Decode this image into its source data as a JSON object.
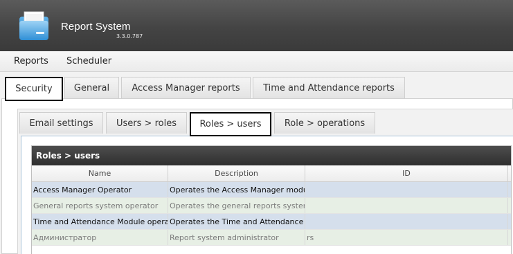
{
  "app": {
    "title": "Report System",
    "version": "3.3.0.787"
  },
  "menu": {
    "items": [
      {
        "label": "Reports"
      },
      {
        "label": "Scheduler"
      }
    ]
  },
  "main_tabs": [
    {
      "label": "Security",
      "active": true
    },
    {
      "label": "General",
      "active": false
    },
    {
      "label": "Access Manager reports",
      "active": false
    },
    {
      "label": "Time and Attendance reports",
      "active": false
    }
  ],
  "sub_tabs": [
    {
      "label": "Email settings",
      "active": false
    },
    {
      "label": "Users > roles",
      "active": false
    },
    {
      "label": "Roles > users",
      "active": true
    },
    {
      "label": "Role > operations",
      "active": false
    }
  ],
  "grid": {
    "title": "Roles > users",
    "columns": [
      "Name",
      "Description",
      "ID"
    ],
    "rows": [
      {
        "name": "Access Manager Operator",
        "description": "Operates the Access Manager modu",
        "id": "",
        "style": "a"
      },
      {
        "name": "General reports system operator",
        "description": "Operates the general reports syster",
        "id": "",
        "style": "b"
      },
      {
        "name": "Time and Attendance Module opera",
        "description": "Operates the Time and Attendance",
        "id": "",
        "style": "a"
      },
      {
        "name": "Администратор",
        "description": "Report system administrator",
        "id": "rs",
        "style": "b"
      }
    ]
  },
  "colors": {
    "header_bg": "#444444",
    "row_selected": "#d5dfec",
    "row_alt": "#e7efe5"
  },
  "icons": {
    "logo": "folder-icon"
  }
}
